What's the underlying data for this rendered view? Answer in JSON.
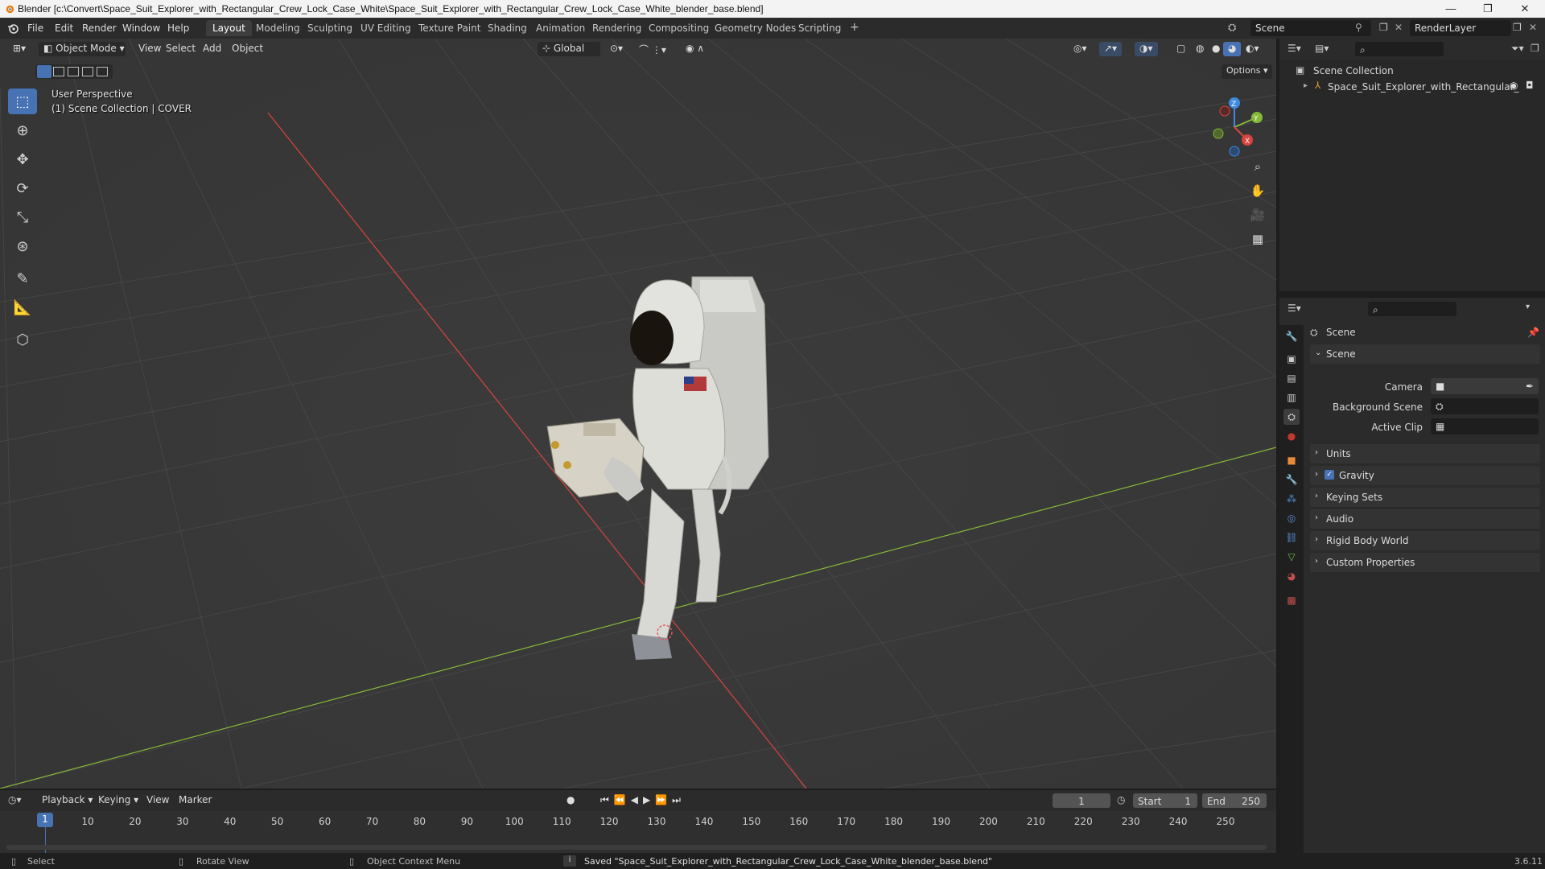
{
  "window": {
    "title": "Blender [c:\\Convert\\Space_Suit_Explorer_with_Rectangular_Crew_Lock_Case_White\\Space_Suit_Explorer_with_Rectangular_Crew_Lock_Case_White_blender_base.blend]",
    "minimize": "—",
    "maximize": "❐",
    "close": "✕"
  },
  "menu": {
    "items": [
      "File",
      "Edit",
      "Render",
      "Window",
      "Help"
    ]
  },
  "workspaces": {
    "tabs": [
      "Layout",
      "Modeling",
      "Sculpting",
      "UV Editing",
      "Texture Paint",
      "Shading",
      "Animation",
      "Rendering",
      "Compositing",
      "Geometry Nodes",
      "Scripting"
    ],
    "active": "Layout",
    "add": "+"
  },
  "scene_selector": {
    "value": "Scene"
  },
  "render_layer": {
    "value": "RenderLayer"
  },
  "viewport_header": {
    "mode": "Object Mode",
    "menus": [
      "View",
      "Select",
      "Add",
      "Object"
    ],
    "orientation": "Global",
    "options": "Options"
  },
  "viewport_overlay": {
    "perspective": "User Perspective",
    "collection": "(1) Scene Collection | COVER"
  },
  "gizmo": {
    "x": "X",
    "y": "Y",
    "z": "Z"
  },
  "outliner": {
    "root": "Scene Collection",
    "items": [
      {
        "label": "Space_Suit_Explorer_with_Rectangular_"
      }
    ]
  },
  "properties": {
    "header": "Scene",
    "panel_title": "Scene",
    "fields": {
      "camera_label": "Camera",
      "background_label": "Background Scene",
      "clip_label": "Active Clip"
    },
    "sections": [
      "Units",
      "Gravity",
      "Keying Sets",
      "Audio",
      "Rigid Body World",
      "Custom Properties"
    ],
    "gravity_checked": true
  },
  "timeline": {
    "menus": [
      "Playback",
      "Keying",
      "View",
      "Marker"
    ],
    "current_frame": "1",
    "start_label": "Start",
    "start_value": "1",
    "end_label": "End",
    "end_value": "250",
    "ticks": [
      "1",
      "10",
      "20",
      "30",
      "40",
      "50",
      "60",
      "70",
      "80",
      "90",
      "100",
      "110",
      "120",
      "130",
      "140",
      "150",
      "160",
      "170",
      "180",
      "190",
      "200",
      "210",
      "220",
      "230",
      "240",
      "250"
    ]
  },
  "statusbar": {
    "select": "Select",
    "rotate": "Rotate View",
    "context": "Object Context Menu",
    "message": "Saved \"Space_Suit_Explorer_with_Rectangular_Crew_Lock_Case_White_blender_base.blend\"",
    "version": "3.6.11"
  },
  "colors": {
    "accent": "#4772b3",
    "x_axis": "#d8443f",
    "y_axis": "#86b83a",
    "z_axis": "#3f8ae0"
  }
}
